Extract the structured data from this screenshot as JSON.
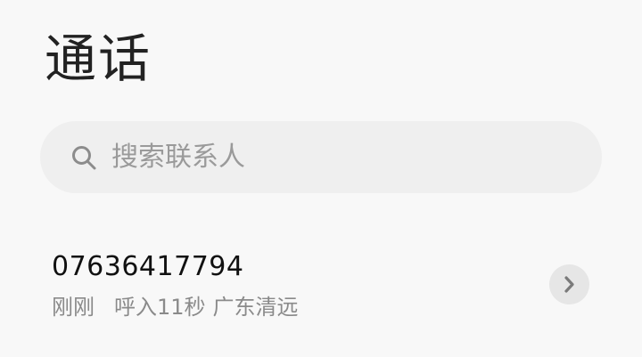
{
  "header": {
    "title": "通话"
  },
  "search": {
    "placeholder": "搜索联系人",
    "icon": "search-icon"
  },
  "calls": [
    {
      "number": "07636417794",
      "time": "刚刚",
      "type_duration": "呼入11秒",
      "location": "广东清远",
      "action_icon": "chevron-right-icon"
    }
  ],
  "colors": {
    "background": "#f8f8f8",
    "search_bg": "#efefef",
    "title": "#222222",
    "secondary_text": "#8a8a8a",
    "detail_button_bg": "#e6e6e6"
  }
}
